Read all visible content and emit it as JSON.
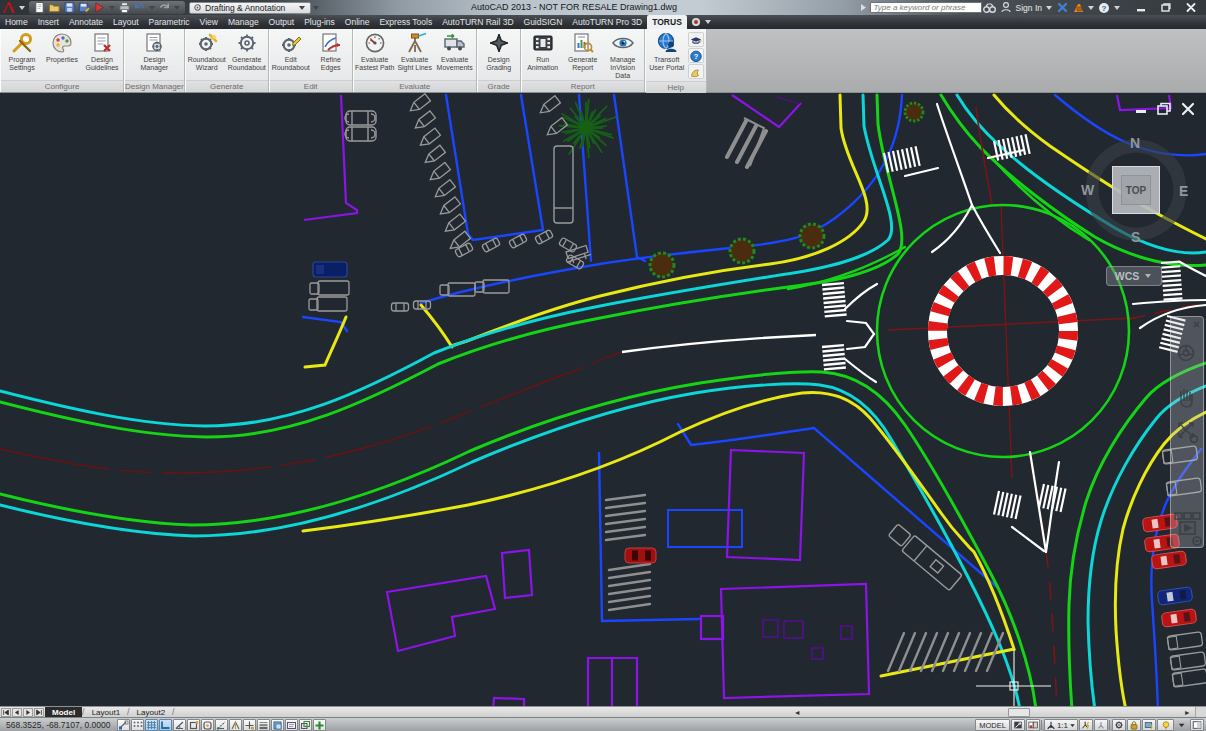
{
  "titlebar": {
    "title": "AutoCAD 2013 - NOT FOR RESALE   Drawing1.dwg",
    "workspace": "Drafting & Annotation",
    "qat_icons": [
      "new-file-icon",
      "open-folder-icon",
      "save-icon",
      "save-as-icon",
      "plot-preview-icon",
      "print-icon",
      "undo-icon",
      "redo-icon"
    ],
    "search_placeholder": "Type a keyword or phrase",
    "search_icon": "binoculars-icon",
    "sign_in": "Sign In",
    "right_icons": [
      "exchange-icon",
      "autodesk-lock-icon",
      "help-icon"
    ]
  },
  "menu": {
    "tabs": [
      {
        "label": "Home"
      },
      {
        "label": "Insert"
      },
      {
        "label": "Annotate"
      },
      {
        "label": "Layout"
      },
      {
        "label": "Parametric"
      },
      {
        "label": "View"
      },
      {
        "label": "Manage"
      },
      {
        "label": "Output"
      },
      {
        "label": "Plug-ins"
      },
      {
        "label": "Online"
      },
      {
        "label": "Express Tools"
      },
      {
        "label": "AutoTURN Rail 3D"
      },
      {
        "label": "GuidSIGN"
      },
      {
        "label": "AutoTURN Pro 3D"
      },
      {
        "label": "TORUS",
        "active": true
      }
    ]
  },
  "ribbon": {
    "groups": [
      {
        "label": "Configure",
        "buttons": [
          {
            "label": "Program Settings",
            "icon": "wrench-icon"
          },
          {
            "label": "Properties",
            "icon": "palette-icon"
          },
          {
            "label": "Design Guidelines",
            "icon": "guidelines-doc-icon"
          }
        ]
      },
      {
        "label": "Design Manager",
        "buttons": [
          {
            "label": "Design Manager",
            "icon": "design-manager-icon"
          }
        ]
      },
      {
        "label": "Generate",
        "buttons": [
          {
            "label": "Roundabout Wizard",
            "icon": "gear-wand-icon"
          },
          {
            "label": "Generate Roundabout",
            "icon": "gear-outline-icon"
          }
        ]
      },
      {
        "label": "Edit",
        "buttons": [
          {
            "label": "Edit Roundabout",
            "icon": "gear-pencil-icon"
          },
          {
            "label": "Refine Edges",
            "icon": "refine-edges-icon"
          }
        ]
      },
      {
        "label": "Evaluate",
        "buttons": [
          {
            "label": "Evaluate Fastest Path",
            "icon": "speedometer-icon"
          },
          {
            "label": "Evaluate Sight Lines",
            "icon": "tripod-icon"
          },
          {
            "label": "Evaluate Movements",
            "icon": "truck-icon"
          }
        ]
      },
      {
        "label": "Grade",
        "buttons": [
          {
            "label": "Design Grading",
            "icon": "grading-icon"
          }
        ]
      },
      {
        "label": "Report",
        "buttons": [
          {
            "label": "Run Animation",
            "icon": "film-icon"
          },
          {
            "label": "Generate Report",
            "icon": "report-icon"
          },
          {
            "label": "Manage InVision Data",
            "icon": "invision-eye-icon"
          }
        ]
      },
      {
        "label": "Help",
        "buttons": [
          {
            "label": "Transoft User Portal",
            "icon": "globe-user-icon"
          }
        ],
        "stack": [
          "training-cap-icon",
          "help-circle-icon",
          "about-icon"
        ]
      }
    ]
  },
  "canvas": {
    "viewcube": {
      "top_face": "TOP",
      "north": "N",
      "south": "S",
      "east": "E",
      "west": "W"
    },
    "ucs_label": "WCS",
    "window_icons": [
      "minimize-icon",
      "restore-icon",
      "close-icon"
    ],
    "navbar_icons": [
      "close-icon",
      "steering-wheel-icon",
      "pan-hand-icon",
      "zoom-arrows-icon",
      "showmotion-icon",
      "play-icon",
      "customize-icon"
    ]
  },
  "layout_tabs": {
    "nav_icons": [
      "first-tab-icon",
      "prev-tab-icon",
      "next-tab-icon",
      "last-tab-icon"
    ],
    "items": [
      {
        "label": "Model",
        "active": true
      },
      {
        "label": "Layout1"
      },
      {
        "label": "Layout2"
      }
    ]
  },
  "statusbar": {
    "coordinates": "568.3525,  -68.7107,  0.0000",
    "toggles": [
      {
        "name": "infer-constraints",
        "icon": "infer-icon",
        "pressed": false
      },
      {
        "name": "snap-mode",
        "icon": "snap-icon",
        "pressed": false
      },
      {
        "name": "grid-display",
        "icon": "grid-icon",
        "pressed": true
      },
      {
        "name": "ortho-mode",
        "icon": "ortho-icon",
        "pressed": true
      },
      {
        "name": "polar-tracking",
        "icon": "polar-icon",
        "pressed": false
      },
      {
        "name": "object-snap",
        "icon": "osnap-icon",
        "pressed": false
      },
      {
        "name": "3d-object-snap",
        "icon": "osnap3d-icon",
        "pressed": false
      },
      {
        "name": "object-snap-tracking",
        "icon": "otrack-icon",
        "pressed": false
      },
      {
        "name": "dynamic-ucs",
        "icon": "ducs-icon",
        "pressed": false
      },
      {
        "name": "dynamic-input",
        "icon": "dyn-icon",
        "pressed": false
      },
      {
        "name": "lineweight",
        "icon": "lwt-icon",
        "pressed": false
      },
      {
        "name": "transparency",
        "icon": "tpy-icon",
        "pressed": false
      },
      {
        "name": "quick-properties",
        "icon": "qp-icon",
        "pressed": false
      },
      {
        "name": "selection-cycling",
        "icon": "sc-icon",
        "pressed": false
      },
      {
        "name": "annotation-monitor",
        "icon": "am-icon",
        "pressed": false
      }
    ],
    "right": {
      "model_label": "MODEL",
      "annotation_scale": "1:1",
      "icons_before_scale": [
        "quickview-layouts-icon",
        "quickview-drawings-icon"
      ],
      "icons_after_scale": [
        "annotation-visibility-icon",
        "autoscale-icon"
      ],
      "tail_icons": [
        "workspace-gear-icon",
        "lock-icon",
        "hardware-accel-icon",
        "isolate-bulb-icon",
        "menu-caret-icon",
        "clean-screen-icon"
      ]
    }
  },
  "colors": {
    "canvas_bg": "#212830",
    "cad_green": "#15d415",
    "cad_cyan": "#0cd6d6",
    "cad_yellow": "#e8e812",
    "cad_blue": "#1a46ff",
    "cad_purple": "#8c14e8",
    "cad_dark_red": "#7d1414",
    "apron_red": "#e01818",
    "vehicle_gray": "#9a9a9a"
  }
}
